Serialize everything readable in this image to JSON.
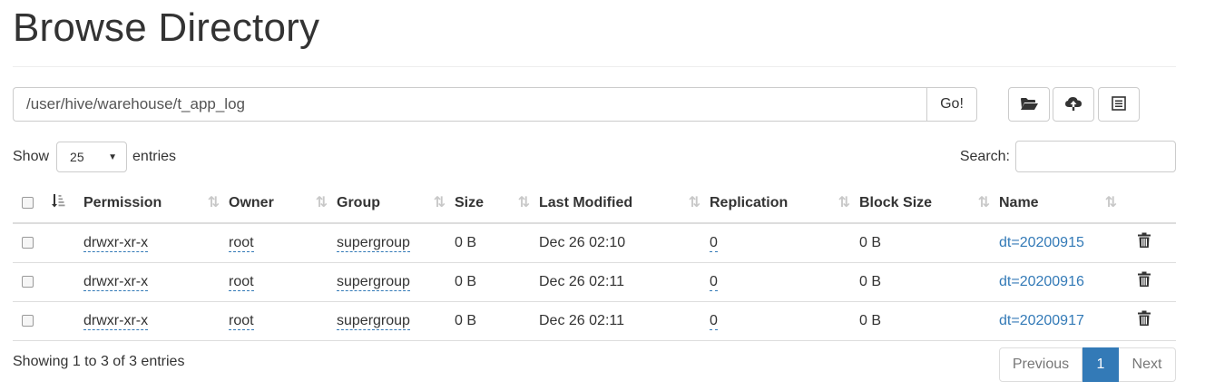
{
  "page": {
    "title": "Browse Directory"
  },
  "path_bar": {
    "value": "/user/hive/warehouse/t_app_log",
    "go_label": "Go!"
  },
  "toolbar": {
    "icons": [
      "folder-open-icon",
      "cloud-upload-icon",
      "list-icon"
    ]
  },
  "length_control": {
    "show_label": "Show",
    "selected": "25",
    "entries_label": "entries"
  },
  "search": {
    "label": "Search:",
    "value": ""
  },
  "table": {
    "columns": [
      "Permission",
      "Owner",
      "Group",
      "Size",
      "Last Modified",
      "Replication",
      "Block Size",
      "Name"
    ],
    "rows": [
      {
        "permission": "drwxr-xr-x",
        "owner": "root",
        "group": "supergroup",
        "size": "0 B",
        "last_modified": "Dec 26 02:10",
        "replication": "0",
        "block_size": "0 B",
        "name": "dt=20200915"
      },
      {
        "permission": "drwxr-xr-x",
        "owner": "root",
        "group": "supergroup",
        "size": "0 B",
        "last_modified": "Dec 26 02:11",
        "replication": "0",
        "block_size": "0 B",
        "name": "dt=20200916"
      },
      {
        "permission": "drwxr-xr-x",
        "owner": "root",
        "group": "supergroup",
        "size": "0 B",
        "last_modified": "Dec 26 02:11",
        "replication": "0",
        "block_size": "0 B",
        "name": "dt=20200917"
      }
    ]
  },
  "footer": {
    "info": "Showing 1 to 3 of 3 entries",
    "previous_label": "Previous",
    "current_page": "1",
    "next_label": "Next"
  },
  "colors": {
    "accent": "#337ab7",
    "border": "#dddddd"
  }
}
